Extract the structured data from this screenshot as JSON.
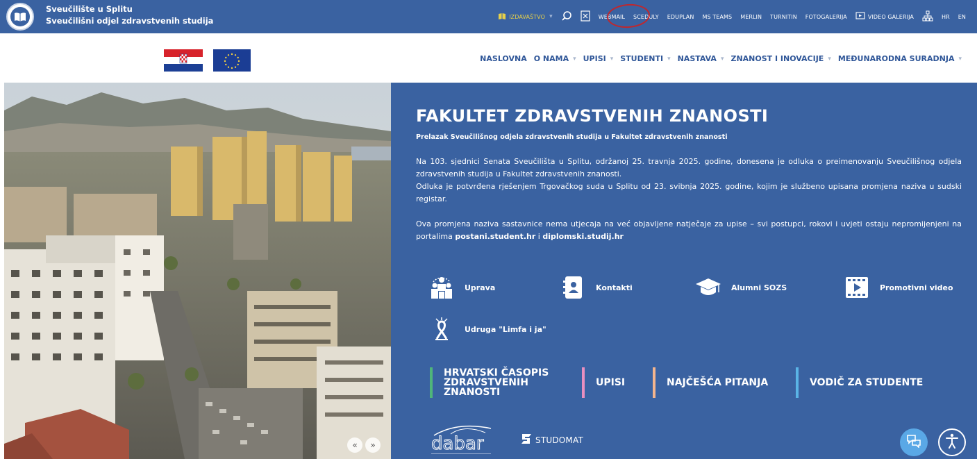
{
  "header": {
    "org_line1": "Sveučilište u Splitu",
    "org_line2": "Sveučilišni odjel zdravstvenih studija",
    "links": {
      "izdavastvo": "IZDAVAŠTVO",
      "webmail": "WEBMAIL",
      "scedulу": "SCEDULY",
      "eduplan": "EDUPLAN",
      "msteams": "MS TEAMS",
      "merlin": "MERLIN",
      "turnitin": "TURNITIN",
      "fotogalerija": "FOTOGALERIJA",
      "videogalerija": "VIDEO GALERIJA",
      "hr": "HR",
      "en": "EN"
    }
  },
  "mainnav": {
    "naslovna": "NASLOVNA",
    "onama": "O NAMA",
    "upisi": "UPISI",
    "studenti": "STUDENTI",
    "nastava": "NASTAVA",
    "znanost": "ZNANOST I INOVACIJE",
    "medunarodna": "MEĐUNARODNA SURADNJA"
  },
  "hero": {
    "title": "FAKULTET ZDRAVSTVENIH ZNANOSTI",
    "subtitle": "Prelazak Sveučilišnog odjela zdravstvenih studija u Fakultet zdravstvenih znanosti",
    "p1": "Na 103. sjednici Senata Sveučilišta u Splitu, održanoj 25. travnja 2025. godine, donesena je odluka o preimenovanju Sveučilišnog odjela zdravstvenih studija u Fakultet zdravstvenih znanosti.",
    "p2": "Odluka je potvrđena rješenjem Trgovačkog suda u Splitu od 23. svibnja 2025. godine, kojim je službeno upisana promjena naziva u sudski registar.",
    "p3_pre": "Ova promjena naziva sastavnice nema utjecaja na već objavljene natječaje za upise – svi postupci, rokovi i uvjeti ostaju nepromijenjeni na portalima ",
    "p3_link1": "postani.student.hr",
    "p3_mid": " i ",
    "p3_link2": "diplomski.studij.hr"
  },
  "quicklinks": {
    "uprava": "Uprava",
    "kontakti": "Kontakti",
    "alumni": "Alumni SOZS",
    "promo": "Promotivni video",
    "udruga": "Udruga \"Limfa i ja\""
  },
  "tiles": {
    "casopis": "HRVATSKI ČASOPIS ZDRAVSTVENIH ZNANOSTI",
    "upisi": "UPISI",
    "pitanja": "NAJČEŠĆA PITANJA",
    "vodic": "VODIČ ZA STUDENTE"
  },
  "footer_logos": {
    "dabar": "dabar",
    "studomat": "STUDOMAT"
  },
  "colors": {
    "brand_blue": "#3a62a1",
    "tile_green": "#4fb57a",
    "tile_pink": "#e88fc0",
    "tile_peach": "#f3b58e",
    "tile_sky": "#5ab4e6"
  }
}
